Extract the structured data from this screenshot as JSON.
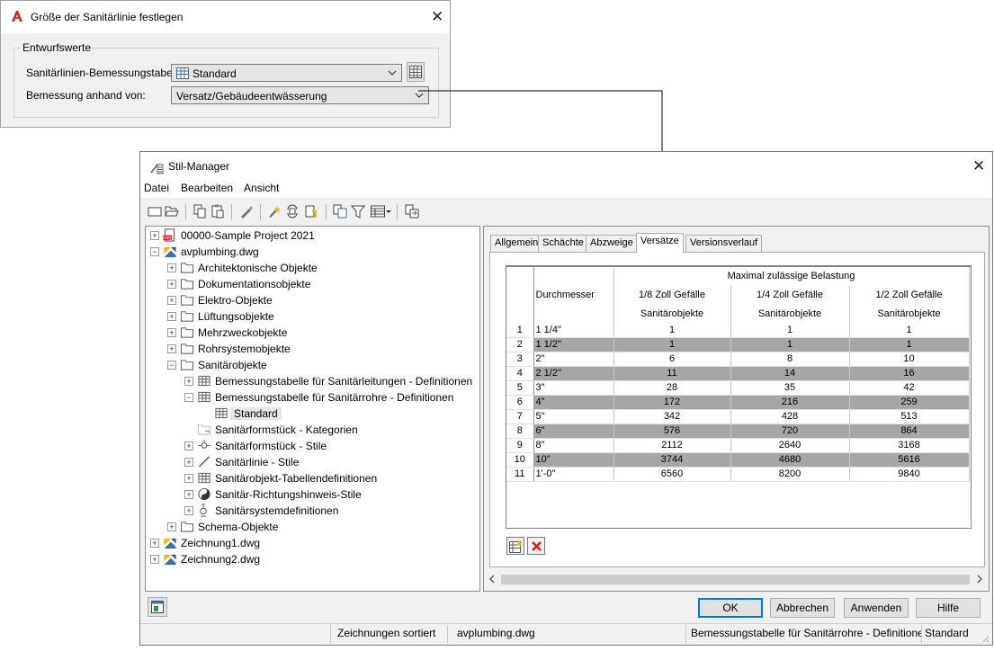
{
  "size_dialog": {
    "title": "Größe der Sanitärlinie festlegen",
    "group_title": "Entwurfswerte",
    "table_label": "Sanitärlinien-Bemessungstabelle:",
    "table_value": "Standard",
    "sizing_label": "Bemessung anhand von:",
    "sizing_value": "Versatz/Gebäudeentwässerung"
  },
  "style_manager": {
    "title": "Stil-Manager",
    "menu": [
      "Datei",
      "Bearbeiten",
      "Ansicht"
    ],
    "toolbar_icons": [
      "new-drawing-icon",
      "open-drawing-icon",
      "copy-icon",
      "paste-icon",
      "edit-style-icon",
      "purge-icon",
      "toggle-view-icon",
      "sort-icon",
      "set-from-icon",
      "filter-icon",
      "view-icon",
      "synchronize-icon"
    ],
    "tree": [
      {
        "label": "00000-Sample Project 2021",
        "icon": "project-file-icon",
        "expander": "+"
      },
      {
        "label": "avplumbing.dwg",
        "icon": "drawing-icon",
        "expander": "-"
      },
      {
        "label": "Architektonische Objekte",
        "icon": "folder-icon",
        "expander": "+"
      },
      {
        "label": "Dokumentationsobjekte",
        "icon": "folder-icon",
        "expander": "+"
      },
      {
        "label": "Elektro-Objekte",
        "icon": "folder-icon",
        "expander": "+"
      },
      {
        "label": "Lüftungsobjekte",
        "icon": "folder-icon",
        "expander": "+"
      },
      {
        "label": "Mehrzweckobjekte",
        "icon": "folder-icon",
        "expander": "+"
      },
      {
        "label": "Rohrsystemobjekte",
        "icon": "folder-icon",
        "expander": "+"
      },
      {
        "label": "Sanitärobjekte",
        "icon": "folder-icon",
        "expander": "-"
      },
      {
        "label": "Bemessungstabelle für Sanitärleitungen - Definitionen",
        "icon": "table-icon",
        "expander": "+"
      },
      {
        "label": "Bemessungstabelle für Sanitärrohre - Definitionen",
        "icon": "table-icon",
        "expander": "-"
      },
      {
        "label": "Standard",
        "icon": "table-icon",
        "expander": ""
      },
      {
        "label": "Sanitärformstück - Kategorien",
        "icon": "category-icon",
        "expander": ""
      },
      {
        "label": "Sanitärformstück - Stile",
        "icon": "fitting-icon",
        "expander": "+"
      },
      {
        "label": "Sanitärlinie - Stile",
        "icon": "line-icon",
        "expander": "+"
      },
      {
        "label": "Sanitärobjekt-Tabellendefinitionen",
        "icon": "table-icon",
        "expander": "+"
      },
      {
        "label": "Sanitär-Richtungshinweis-Stile",
        "icon": "direction-icon",
        "expander": "+"
      },
      {
        "label": "Sanitärsystemdefinitionen",
        "icon": "system-icon",
        "expander": "+"
      },
      {
        "label": "Schema-Objekte",
        "icon": "folder-icon",
        "expander": "+"
      },
      {
        "label": "Zeichnung1.dwg",
        "icon": "drawing-icon",
        "expander": "+"
      },
      {
        "label": "Zeichnung2.dwg",
        "icon": "drawing-icon",
        "expander": "+"
      }
    ],
    "tabs": [
      "Allgemein",
      "Schächte",
      "Abzweige",
      "Versätze",
      "Versionsverlauf"
    ],
    "active_tab": "Versätze",
    "grid": {
      "group_header": "Maximal zulässige Belastung",
      "columns": [
        {
          "line1": "Durchmesser",
          "line2": ""
        },
        {
          "line1": "1/8 Zoll Gefälle",
          "line2": "Sanitärobjekte"
        },
        {
          "line1": "1/4 Zoll Gefälle",
          "line2": "Sanitärobjekte"
        },
        {
          "line1": "1/2 Zoll Gefälle",
          "line2": "Sanitärobjekte"
        }
      ],
      "rows": [
        {
          "n": "1",
          "d": "1 1/4\"",
          "a": "1",
          "b": "1",
          "c": "1"
        },
        {
          "n": "2",
          "d": "1 1/2\"",
          "a": "1",
          "b": "1",
          "c": "1"
        },
        {
          "n": "3",
          "d": "2\"",
          "a": "6",
          "b": "8",
          "c": "10"
        },
        {
          "n": "4",
          "d": "2 1/2\"",
          "a": "11",
          "b": "14",
          "c": "16"
        },
        {
          "n": "5",
          "d": "3\"",
          "a": "28",
          "b": "35",
          "c": "42"
        },
        {
          "n": "6",
          "d": "4\"",
          "a": "172",
          "b": "216",
          "c": "259"
        },
        {
          "n": "7",
          "d": "5\"",
          "a": "342",
          "b": "428",
          "c": "513"
        },
        {
          "n": "8",
          "d": "6\"",
          "a": "576",
          "b": "720",
          "c": "864"
        },
        {
          "n": "9",
          "d": "8\"",
          "a": "2112",
          "b": "2640",
          "c": "3168"
        },
        {
          "n": "10",
          "d": "10\"",
          "a": "3744",
          "b": "4680",
          "c": "5616"
        },
        {
          "n": "11",
          "d": "1'-0\"",
          "a": "6560",
          "b": "8200",
          "c": "9840"
        }
      ],
      "stripe_color": "#a6a6a6"
    },
    "buttons": {
      "ok": "OK",
      "cancel": "Abbrechen",
      "apply": "Anwenden",
      "help": "Hilfe"
    },
    "status": {
      "sort": "Zeichnungen sortiert",
      "drawing": "avplumbing.dwg",
      "type": "Bemessungstabelle für Sanitärrohre - Definitione",
      "style": "Standard"
    }
  }
}
